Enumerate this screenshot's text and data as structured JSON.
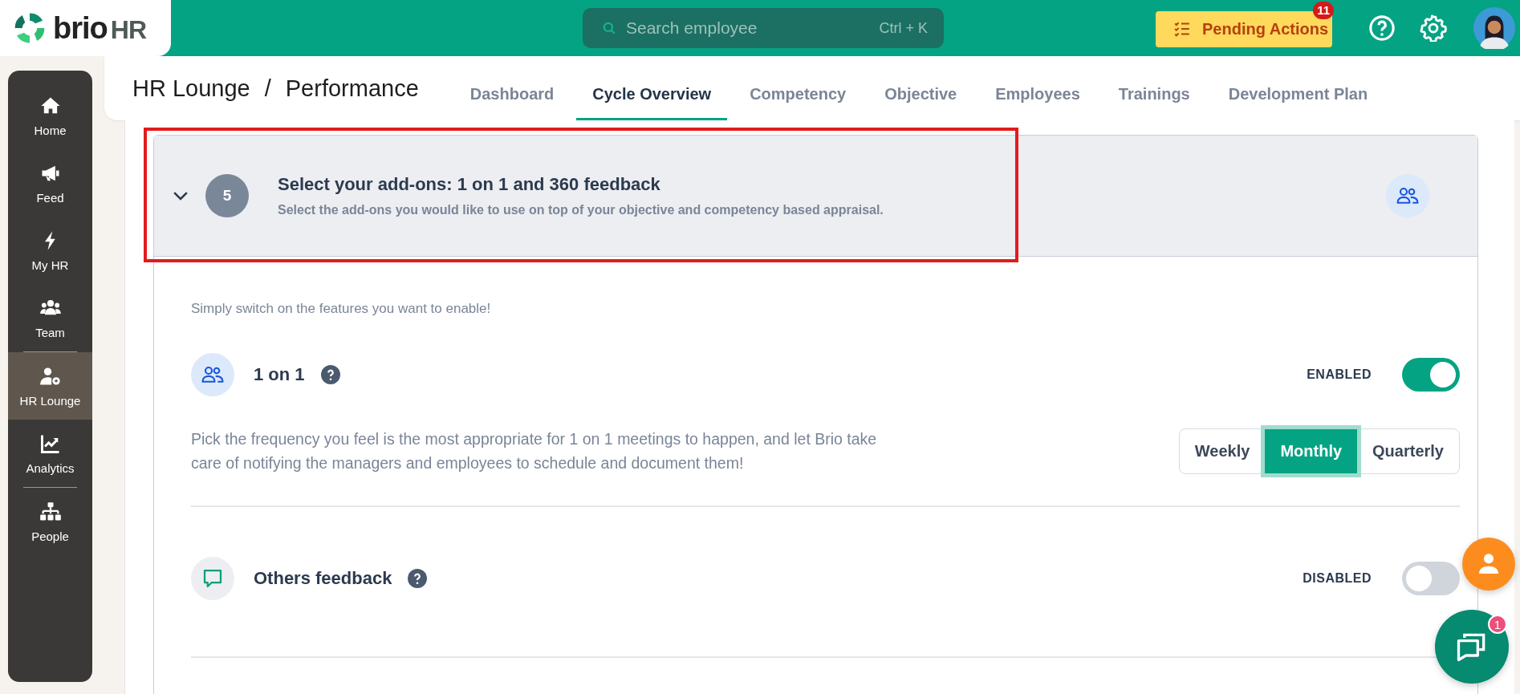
{
  "logo": {
    "text": "brio",
    "suffix": "HR"
  },
  "search": {
    "placeholder": "Search employee",
    "shortcut": "Ctrl + K"
  },
  "pending_actions": {
    "label": "Pending Actions",
    "badge": "11"
  },
  "sidebar": {
    "groups": [
      [
        {
          "label": "Home",
          "kind": "home",
          "selected": false
        },
        {
          "label": "Feed",
          "kind": "megaphone",
          "selected": false
        },
        {
          "label": "My HR",
          "kind": "bolt",
          "selected": false
        },
        {
          "label": "Team",
          "kind": "team",
          "selected": false
        }
      ],
      [
        {
          "label": "HR Lounge",
          "kind": "usergear",
          "selected": true
        },
        {
          "label": "Analytics",
          "kind": "chart",
          "selected": false
        }
      ],
      [
        {
          "label": "People",
          "kind": "org",
          "selected": false
        }
      ]
    ]
  },
  "breadcrumb": {
    "parent": "HR Lounge",
    "separator": "/",
    "current": "Performance"
  },
  "tabs": [
    {
      "label": "Dashboard",
      "selected": false
    },
    {
      "label": "Cycle Overview",
      "selected": true
    },
    {
      "label": "Competency",
      "selected": false
    },
    {
      "label": "Objective",
      "selected": false
    },
    {
      "label": "Employees",
      "selected": false
    },
    {
      "label": "Trainings",
      "selected": false
    },
    {
      "label": "Development Plan",
      "selected": false
    }
  ],
  "step": {
    "number": "5",
    "title": "Select your add-ons: 1 on 1 and 360 feedback",
    "subtitle": "Select the add-ons you would like to use on top of your objective and competency based appraisal.",
    "expanded": true,
    "highlighted": true
  },
  "intro": "Simply switch on the features you want to enable!",
  "features": [
    {
      "name": "1 on 1",
      "kind": "people",
      "status": "ENABLED",
      "on": true,
      "description": "Pick the frequency you feel is the most appropriate for 1 on 1 meetings to happen, and let Brio take care of notifying the managers and employees to schedule and document them!",
      "frequency": [
        {
          "label": "Weekly",
          "selected": false
        },
        {
          "label": "Monthly",
          "selected": true
        },
        {
          "label": "Quarterly",
          "selected": false
        }
      ]
    },
    {
      "name": "Others feedback",
      "kind": "chat",
      "status": "DISABLED",
      "on": false
    }
  ],
  "chat_badge": "1"
}
